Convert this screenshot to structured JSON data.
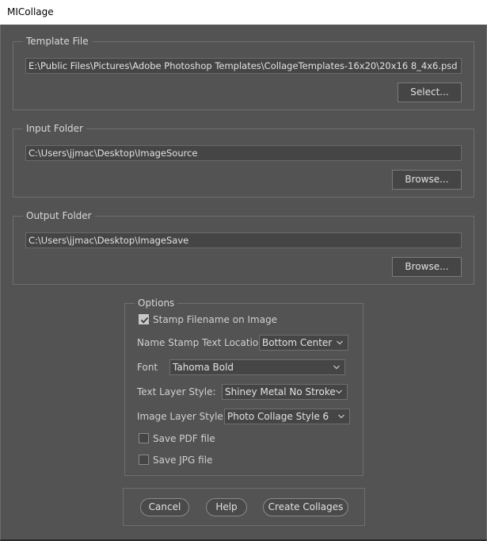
{
  "window": {
    "title": "MICollage"
  },
  "template_file": {
    "label": "Template File",
    "path": "E:\\Public Files\\Pictures\\Adobe Photoshop Templates\\CollageTemplates-16x20\\20x16 8_4x6.psd",
    "button": "Select..."
  },
  "input_folder": {
    "label": "Input Folder",
    "path": "C:\\Users\\jjmac\\Desktop\\ImageSource",
    "button": "Browse..."
  },
  "output_folder": {
    "label": "Output Folder",
    "path": "C:\\Users\\jjmac\\Desktop\\ImageSave",
    "button": "Browse..."
  },
  "options": {
    "label": "Options",
    "stamp_filename": {
      "label": "Stamp Filename on Image",
      "checked": true
    },
    "stamp_location": {
      "label": "Name Stamp Text  Location:",
      "value": "Bottom Center"
    },
    "font": {
      "label": "Font",
      "value": "Tahoma Bold"
    },
    "text_layer_style": {
      "label": "Text Layer Style:",
      "value": "Shiney Metal No Stroke"
    },
    "image_layer_style": {
      "label": "Image Layer Style:",
      "value": "Photo Collage Style 6"
    },
    "save_pdf": {
      "label": "Save PDF file",
      "checked": false
    },
    "save_jpg": {
      "label": "Save JPG file",
      "checked": false
    }
  },
  "actions": {
    "cancel": "Cancel",
    "help": "Help",
    "create": "Create Collages"
  },
  "colors": {
    "background": "#535353",
    "field": "#454545",
    "border": "#6e6e6e",
    "titlebar": "#ffffff"
  }
}
